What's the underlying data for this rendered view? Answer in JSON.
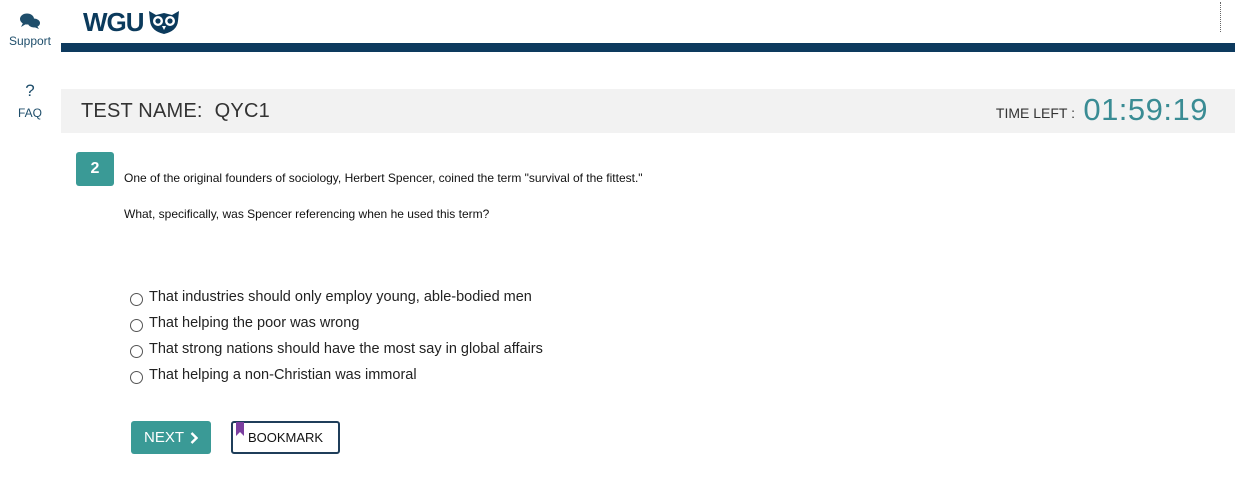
{
  "sidebar": {
    "support": {
      "label": "Support",
      "icon": "chat-bubbles-icon"
    },
    "faq": {
      "label": "FAQ",
      "icon_glyph": "?"
    }
  },
  "header": {
    "logo_text": "WGU",
    "logo_icon": "owl-icon"
  },
  "test": {
    "name_label": "TEST NAME:",
    "name_value": "QYC1",
    "time_label": "TIME LEFT :",
    "time_value": "01:59:19"
  },
  "question": {
    "number": "2",
    "line1": "One of the original founders of sociology, Herbert Spencer, coined the term \"survival of the fittest.\"",
    "line2": "What, specifically, was Spencer referencing when he used this term?",
    "options": [
      "That industries should only employ young, able-bodied men",
      "That helping the poor was wrong",
      "That strong nations should have the most say in global affairs",
      "That helping a non-Christian was immoral"
    ]
  },
  "actions": {
    "next_label": "NEXT",
    "next_icon": "chevron-right-icon",
    "bookmark_label": "BOOKMARK",
    "bookmark_icon": "bookmark-flag-icon"
  },
  "colors": {
    "brand_navy": "#0d3a5e",
    "accent_teal": "#3a9a96",
    "timer_teal": "#3a8c94",
    "bookmark_purple": "#7b3fa0"
  }
}
